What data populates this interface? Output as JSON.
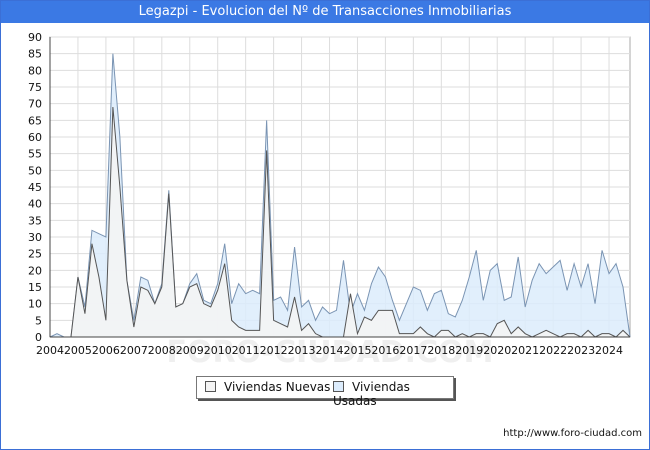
{
  "title": "Legazpi - Evolucion del Nº de Transacciones Inmobiliarias",
  "source": "http://www.foro-ciudad.com",
  "watermark": "FORO-CIUDAD.COM",
  "colors": {
    "title_bg": "#3b79e4",
    "nuevas_fill": "#f4f4f4",
    "nuevas_line": "#555555",
    "usadas_fill": "#dcecfc",
    "usadas_line": "#7a94b3"
  },
  "chart_data": {
    "type": "area",
    "title": "Legazpi - Evolucion del Nº de Transacciones Inmobiliarias",
    "xlabel": "",
    "ylabel": "",
    "ylim": [
      0,
      90
    ],
    "xlim": [
      2004,
      2024.75
    ],
    "yticks": [
      0,
      5,
      10,
      15,
      20,
      25,
      30,
      35,
      40,
      45,
      50,
      55,
      60,
      65,
      70,
      75,
      80,
      85,
      90
    ],
    "xticks": [
      "2004",
      "2005",
      "2006",
      "2007",
      "2008",
      "2009",
      "2010",
      "2011",
      "2012",
      "2013",
      "2014",
      "2015",
      "2016",
      "2017",
      "2018",
      "2019",
      "2020",
      "2021",
      "2022",
      "2023",
      "2024"
    ],
    "grid": true,
    "legend_position": "bottom-center",
    "x": [
      2004.0,
      2004.25,
      2004.5,
      2004.75,
      2005.0,
      2005.25,
      2005.5,
      2005.75,
      2006.0,
      2006.25,
      2006.5,
      2006.75,
      2007.0,
      2007.25,
      2007.5,
      2007.75,
      2008.0,
      2008.25,
      2008.5,
      2008.75,
      2009.0,
      2009.25,
      2009.5,
      2009.75,
      2010.0,
      2010.25,
      2010.5,
      2010.75,
      2011.0,
      2011.25,
      2011.5,
      2011.75,
      2012.0,
      2012.25,
      2012.5,
      2012.75,
      2013.0,
      2013.25,
      2013.5,
      2013.75,
      2014.0,
      2014.25,
      2014.5,
      2014.75,
      2015.0,
      2015.25,
      2015.5,
      2015.75,
      2016.0,
      2016.25,
      2016.5,
      2016.75,
      2017.0,
      2017.25,
      2017.5,
      2017.75,
      2018.0,
      2018.25,
      2018.5,
      2018.75,
      2019.0,
      2019.25,
      2019.5,
      2019.75,
      2020.0,
      2020.25,
      2020.5,
      2020.75,
      2021.0,
      2021.25,
      2021.5,
      2021.75,
      2022.0,
      2022.25,
      2022.5,
      2022.75,
      2023.0,
      2023.25,
      2023.5,
      2023.75,
      2024.0,
      2024.25,
      2024.5,
      2024.75
    ],
    "series": [
      {
        "name": "Viviendas Nuevas",
        "values": [
          0,
          0,
          0,
          0,
          18,
          7,
          28,
          18,
          5,
          69,
          45,
          17,
          3,
          15,
          14,
          10,
          15,
          43,
          9,
          10,
          15,
          16,
          10,
          9,
          14,
          22,
          5,
          3,
          2,
          2,
          2,
          56,
          5,
          4,
          3,
          12,
          2,
          4,
          1,
          0,
          0,
          0,
          0,
          13,
          1,
          6,
          5,
          8,
          8,
          8,
          1,
          1,
          1,
          3,
          1,
          0,
          2,
          2,
          0,
          1,
          0,
          1,
          1,
          0,
          4,
          5,
          1,
          3,
          1,
          0,
          1,
          2,
          1,
          0,
          1,
          1,
          0,
          2,
          0,
          1,
          1,
          0,
          2,
          0
        ]
      },
      {
        "name": "Viviendas Usadas",
        "values": [
          0,
          1,
          0,
          0,
          18,
          9,
          32,
          31,
          30,
          85,
          60,
          17,
          5,
          18,
          17,
          10,
          16,
          44,
          9,
          10,
          16,
          19,
          11,
          10,
          16,
          28,
          10,
          16,
          13,
          14,
          13,
          65,
          11,
          12,
          8,
          27,
          9,
          11,
          5,
          9,
          7,
          8,
          23,
          7,
          13,
          8,
          16,
          21,
          18,
          11,
          5,
          10,
          15,
          14,
          8,
          13,
          14,
          7,
          6,
          11,
          18,
          26,
          11,
          20,
          22,
          11,
          12,
          24,
          9,
          17,
          22,
          19,
          21,
          23,
          14,
          22,
          15,
          22,
          10,
          26,
          19,
          22,
          15,
          0
        ]
      }
    ]
  },
  "legend": {
    "items": [
      "Viviendas Nuevas",
      "Viviendas Usadas"
    ]
  }
}
